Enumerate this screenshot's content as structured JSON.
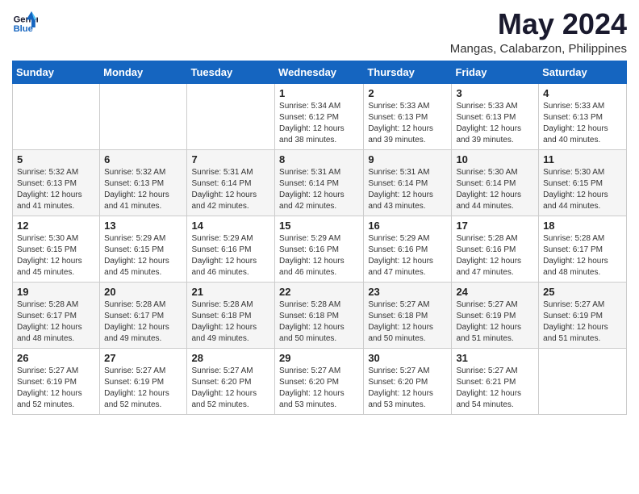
{
  "logo": {
    "text_general": "General",
    "text_blue": "Blue"
  },
  "header": {
    "month_year": "May 2024",
    "location": "Mangas, Calabarzon, Philippines"
  },
  "weekdays": [
    "Sunday",
    "Monday",
    "Tuesday",
    "Wednesday",
    "Thursday",
    "Friday",
    "Saturday"
  ],
  "weeks": [
    [
      {
        "day": "",
        "sunrise": "",
        "sunset": "",
        "daylight": ""
      },
      {
        "day": "",
        "sunrise": "",
        "sunset": "",
        "daylight": ""
      },
      {
        "day": "",
        "sunrise": "",
        "sunset": "",
        "daylight": ""
      },
      {
        "day": "1",
        "sunrise": "Sunrise: 5:34 AM",
        "sunset": "Sunset: 6:12 PM",
        "daylight": "Daylight: 12 hours and 38 minutes."
      },
      {
        "day": "2",
        "sunrise": "Sunrise: 5:33 AM",
        "sunset": "Sunset: 6:13 PM",
        "daylight": "Daylight: 12 hours and 39 minutes."
      },
      {
        "day": "3",
        "sunrise": "Sunrise: 5:33 AM",
        "sunset": "Sunset: 6:13 PM",
        "daylight": "Daylight: 12 hours and 39 minutes."
      },
      {
        "day": "4",
        "sunrise": "Sunrise: 5:33 AM",
        "sunset": "Sunset: 6:13 PM",
        "daylight": "Daylight: 12 hours and 40 minutes."
      }
    ],
    [
      {
        "day": "5",
        "sunrise": "Sunrise: 5:32 AM",
        "sunset": "Sunset: 6:13 PM",
        "daylight": "Daylight: 12 hours and 41 minutes."
      },
      {
        "day": "6",
        "sunrise": "Sunrise: 5:32 AM",
        "sunset": "Sunset: 6:13 PM",
        "daylight": "Daylight: 12 hours and 41 minutes."
      },
      {
        "day": "7",
        "sunrise": "Sunrise: 5:31 AM",
        "sunset": "Sunset: 6:14 PM",
        "daylight": "Daylight: 12 hours and 42 minutes."
      },
      {
        "day": "8",
        "sunrise": "Sunrise: 5:31 AM",
        "sunset": "Sunset: 6:14 PM",
        "daylight": "Daylight: 12 hours and 42 minutes."
      },
      {
        "day": "9",
        "sunrise": "Sunrise: 5:31 AM",
        "sunset": "Sunset: 6:14 PM",
        "daylight": "Daylight: 12 hours and 43 minutes."
      },
      {
        "day": "10",
        "sunrise": "Sunrise: 5:30 AM",
        "sunset": "Sunset: 6:14 PM",
        "daylight": "Daylight: 12 hours and 44 minutes."
      },
      {
        "day": "11",
        "sunrise": "Sunrise: 5:30 AM",
        "sunset": "Sunset: 6:15 PM",
        "daylight": "Daylight: 12 hours and 44 minutes."
      }
    ],
    [
      {
        "day": "12",
        "sunrise": "Sunrise: 5:30 AM",
        "sunset": "Sunset: 6:15 PM",
        "daylight": "Daylight: 12 hours and 45 minutes."
      },
      {
        "day": "13",
        "sunrise": "Sunrise: 5:29 AM",
        "sunset": "Sunset: 6:15 PM",
        "daylight": "Daylight: 12 hours and 45 minutes."
      },
      {
        "day": "14",
        "sunrise": "Sunrise: 5:29 AM",
        "sunset": "Sunset: 6:16 PM",
        "daylight": "Daylight: 12 hours and 46 minutes."
      },
      {
        "day": "15",
        "sunrise": "Sunrise: 5:29 AM",
        "sunset": "Sunset: 6:16 PM",
        "daylight": "Daylight: 12 hours and 46 minutes."
      },
      {
        "day": "16",
        "sunrise": "Sunrise: 5:29 AM",
        "sunset": "Sunset: 6:16 PM",
        "daylight": "Daylight: 12 hours and 47 minutes."
      },
      {
        "day": "17",
        "sunrise": "Sunrise: 5:28 AM",
        "sunset": "Sunset: 6:16 PM",
        "daylight": "Daylight: 12 hours and 47 minutes."
      },
      {
        "day": "18",
        "sunrise": "Sunrise: 5:28 AM",
        "sunset": "Sunset: 6:17 PM",
        "daylight": "Daylight: 12 hours and 48 minutes."
      }
    ],
    [
      {
        "day": "19",
        "sunrise": "Sunrise: 5:28 AM",
        "sunset": "Sunset: 6:17 PM",
        "daylight": "Daylight: 12 hours and 48 minutes."
      },
      {
        "day": "20",
        "sunrise": "Sunrise: 5:28 AM",
        "sunset": "Sunset: 6:17 PM",
        "daylight": "Daylight: 12 hours and 49 minutes."
      },
      {
        "day": "21",
        "sunrise": "Sunrise: 5:28 AM",
        "sunset": "Sunset: 6:18 PM",
        "daylight": "Daylight: 12 hours and 49 minutes."
      },
      {
        "day": "22",
        "sunrise": "Sunrise: 5:28 AM",
        "sunset": "Sunset: 6:18 PM",
        "daylight": "Daylight: 12 hours and 50 minutes."
      },
      {
        "day": "23",
        "sunrise": "Sunrise: 5:27 AM",
        "sunset": "Sunset: 6:18 PM",
        "daylight": "Daylight: 12 hours and 50 minutes."
      },
      {
        "day": "24",
        "sunrise": "Sunrise: 5:27 AM",
        "sunset": "Sunset: 6:19 PM",
        "daylight": "Daylight: 12 hours and 51 minutes."
      },
      {
        "day": "25",
        "sunrise": "Sunrise: 5:27 AM",
        "sunset": "Sunset: 6:19 PM",
        "daylight": "Daylight: 12 hours and 51 minutes."
      }
    ],
    [
      {
        "day": "26",
        "sunrise": "Sunrise: 5:27 AM",
        "sunset": "Sunset: 6:19 PM",
        "daylight": "Daylight: 12 hours and 52 minutes."
      },
      {
        "day": "27",
        "sunrise": "Sunrise: 5:27 AM",
        "sunset": "Sunset: 6:19 PM",
        "daylight": "Daylight: 12 hours and 52 minutes."
      },
      {
        "day": "28",
        "sunrise": "Sunrise: 5:27 AM",
        "sunset": "Sunset: 6:20 PM",
        "daylight": "Daylight: 12 hours and 52 minutes."
      },
      {
        "day": "29",
        "sunrise": "Sunrise: 5:27 AM",
        "sunset": "Sunset: 6:20 PM",
        "daylight": "Daylight: 12 hours and 53 minutes."
      },
      {
        "day": "30",
        "sunrise": "Sunrise: 5:27 AM",
        "sunset": "Sunset: 6:20 PM",
        "daylight": "Daylight: 12 hours and 53 minutes."
      },
      {
        "day": "31",
        "sunrise": "Sunrise: 5:27 AM",
        "sunset": "Sunset: 6:21 PM",
        "daylight": "Daylight: 12 hours and 54 minutes."
      },
      {
        "day": "",
        "sunrise": "",
        "sunset": "",
        "daylight": ""
      }
    ]
  ]
}
